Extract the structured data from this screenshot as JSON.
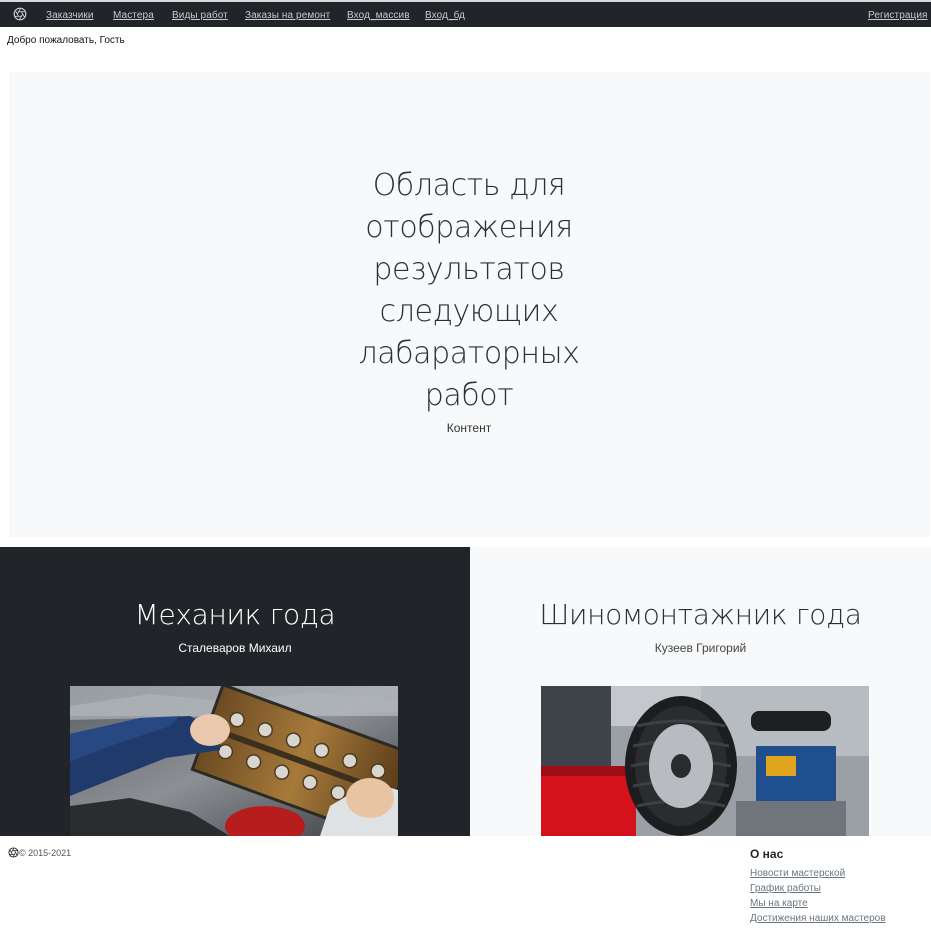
{
  "nav": {
    "items": [
      {
        "label": "Заказчики"
      },
      {
        "label": "Мастера"
      },
      {
        "label": "Виды работ"
      },
      {
        "label": "Заказы на ремонт"
      },
      {
        "label": "Вход_массив"
      },
      {
        "label": "Вход_бд"
      }
    ],
    "register": "Регистрация",
    "logo_icon": "aperture-icon"
  },
  "welcome": "Добро пожаловать, Гость",
  "hero": {
    "title": "Область для отображения результатов следующих лабараторных работ",
    "subtitle": "Контент"
  },
  "panels": [
    {
      "title": "Механик года",
      "name": "Сталеваров Михаил",
      "image": "engine-repair-photo"
    },
    {
      "title": "Шиномонтажник года",
      "name": "Кузеев Григорий",
      "image": "tire-service-photo"
    }
  ],
  "footer": {
    "copyright": "© 2015-2021",
    "about_heading": "О нас",
    "links": [
      {
        "label": "Новости мастерской"
      },
      {
        "label": "График работы"
      },
      {
        "label": "Мы на карте"
      },
      {
        "label": "Достижения наших мастеров"
      }
    ]
  },
  "colors": {
    "dark": "#212529",
    "light": "#f8f9fa",
    "nav_text": "#c8cbcf"
  }
}
